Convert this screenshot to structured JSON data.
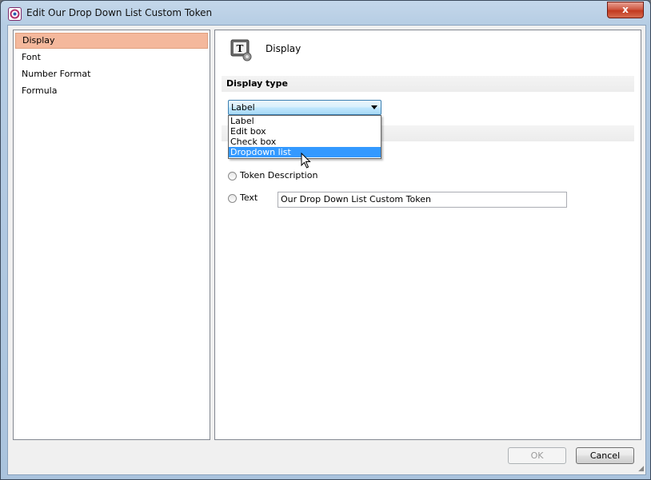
{
  "window": {
    "title": "Edit Our Drop Down List Custom Token",
    "close_glyph": "x"
  },
  "nav": {
    "items": [
      {
        "label": "Display",
        "selected": true
      },
      {
        "label": "Font",
        "selected": false
      },
      {
        "label": "Number Format",
        "selected": false
      },
      {
        "label": "Formula",
        "selected": false
      }
    ]
  },
  "panel": {
    "title": "Display",
    "icon": "text-token-settings-icon",
    "display_type": {
      "header": "Display type",
      "selected": "Label",
      "options": [
        "Label",
        "Edit box",
        "Check box",
        "Dropdown list"
      ],
      "highlighted": "Dropdown list"
    },
    "text_section": {
      "radio_token_description": "Token Description",
      "radio_text": "Text",
      "text_value": "Our Drop Down List Custom Token"
    }
  },
  "buttons": {
    "ok": "OK",
    "cancel": "Cancel"
  },
  "colors": {
    "nav_selected": "#f4b89c",
    "highlight": "#3399ff",
    "close_button": "#c23a20"
  }
}
